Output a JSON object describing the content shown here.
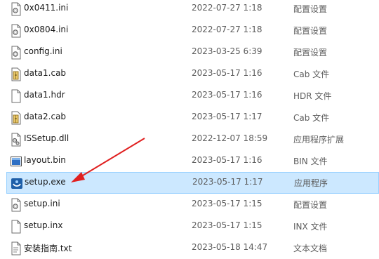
{
  "files": [
    {
      "name": "0x0411.ini",
      "date": "2022-07-27 1:18",
      "type": "配置设置",
      "icon": "settings-file-icon"
    },
    {
      "name": "0x0804.ini",
      "date": "2022-07-27 1:18",
      "type": "配置设置",
      "icon": "settings-file-icon"
    },
    {
      "name": "config.ini",
      "date": "2023-03-25 6:39",
      "type": "配置设置",
      "icon": "settings-file-icon"
    },
    {
      "name": "data1.cab",
      "date": "2023-05-17 1:16",
      "type": "Cab 文件",
      "icon": "cabinet-file-icon"
    },
    {
      "name": "data1.hdr",
      "date": "2023-05-17 1:16",
      "type": "HDR 文件",
      "icon": "blank-file-icon"
    },
    {
      "name": "data2.cab",
      "date": "2023-05-17 1:17",
      "type": "Cab 文件",
      "icon": "cabinet-file-icon"
    },
    {
      "name": "ISSetup.dll",
      "date": "2022-12-07 18:59",
      "type": "应用程序扩展",
      "icon": "dll-file-icon"
    },
    {
      "name": "layout.bin",
      "date": "2023-05-17 1:16",
      "type": "BIN 文件",
      "icon": "binary-file-icon"
    },
    {
      "name": "setup.exe",
      "date": "2023-05-17 1:17",
      "type": "应用程序",
      "icon": "installer-app-icon",
      "selected": true
    },
    {
      "name": "setup.ini",
      "date": "2023-05-17 1:15",
      "type": "配置设置",
      "icon": "settings-file-icon"
    },
    {
      "name": "setup.inx",
      "date": "2023-05-17 1:15",
      "type": "INX 文件",
      "icon": "blank-file-icon"
    },
    {
      "name": "安装指南.txt",
      "date": "2023-05-18 14:47",
      "type": "文本文档",
      "icon": "text-file-icon"
    }
  ],
  "colors": {
    "selection_background": "#cce8ff",
    "selection_border": "#99d1ff",
    "annotation_arrow": "#e02020"
  }
}
